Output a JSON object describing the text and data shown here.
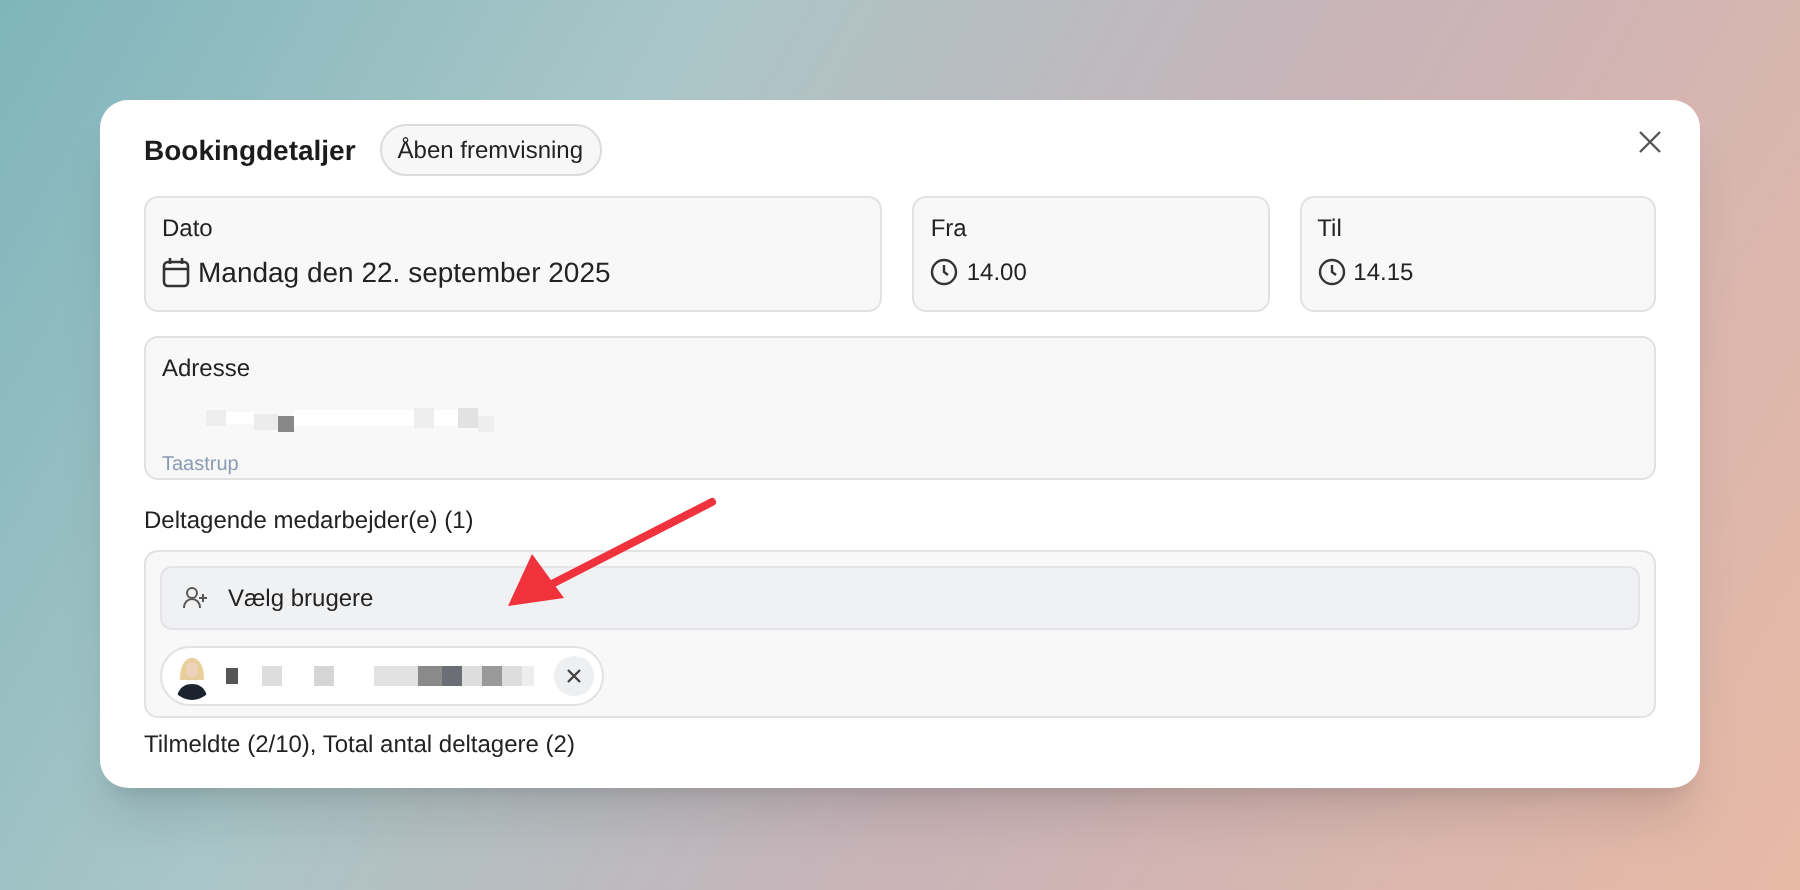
{
  "dialog": {
    "title": "Bookingdetaljer",
    "badge": "Åben fremvisning"
  },
  "fields": [
    {
      "label": "Dato",
      "value": "Mandag den 22. september 2025",
      "kind": "date"
    },
    {
      "label": "Fra",
      "value": "14.00",
      "kind": "time"
    },
    {
      "label": "Til",
      "value": "14.15",
      "kind": "time"
    }
  ],
  "address": {
    "label": "Adresse",
    "city": "Taastrup"
  },
  "participants": {
    "heading": "Deltagende medarbejder(e) (1)",
    "select_button": "Vælg brugere",
    "chips": [
      {
        "kind": "user"
      }
    ]
  },
  "footer_text": "Tilmeldte (2/10), Total antal deltagere (2)"
}
